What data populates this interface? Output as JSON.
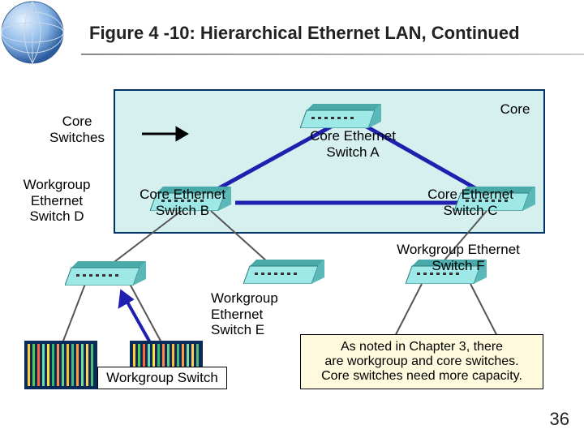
{
  "title": "Figure 4 -10: Hierarchical Ethernet LAN, Continued",
  "labels": {
    "core_switches": "Core\nSwitches",
    "core": "Core",
    "switch_a": "Core Ethernet\nSwitch A",
    "switch_b": "Core Ethernet\nSwitch B",
    "switch_c": "Core Ethernet\nSwitch C",
    "switch_d": "Workgroup\nEthernet\nSwitch D",
    "switch_e": "Workgroup\nEthernet\nSwitch E",
    "switch_f": "Workgroup Ethernet\nSwitch F",
    "workgroup_switch": "Workgroup Switch"
  },
  "note": "As noted in Chapter 3, there\nare workgroup and core switches.\nCore switches need more capacity.",
  "page": "36"
}
